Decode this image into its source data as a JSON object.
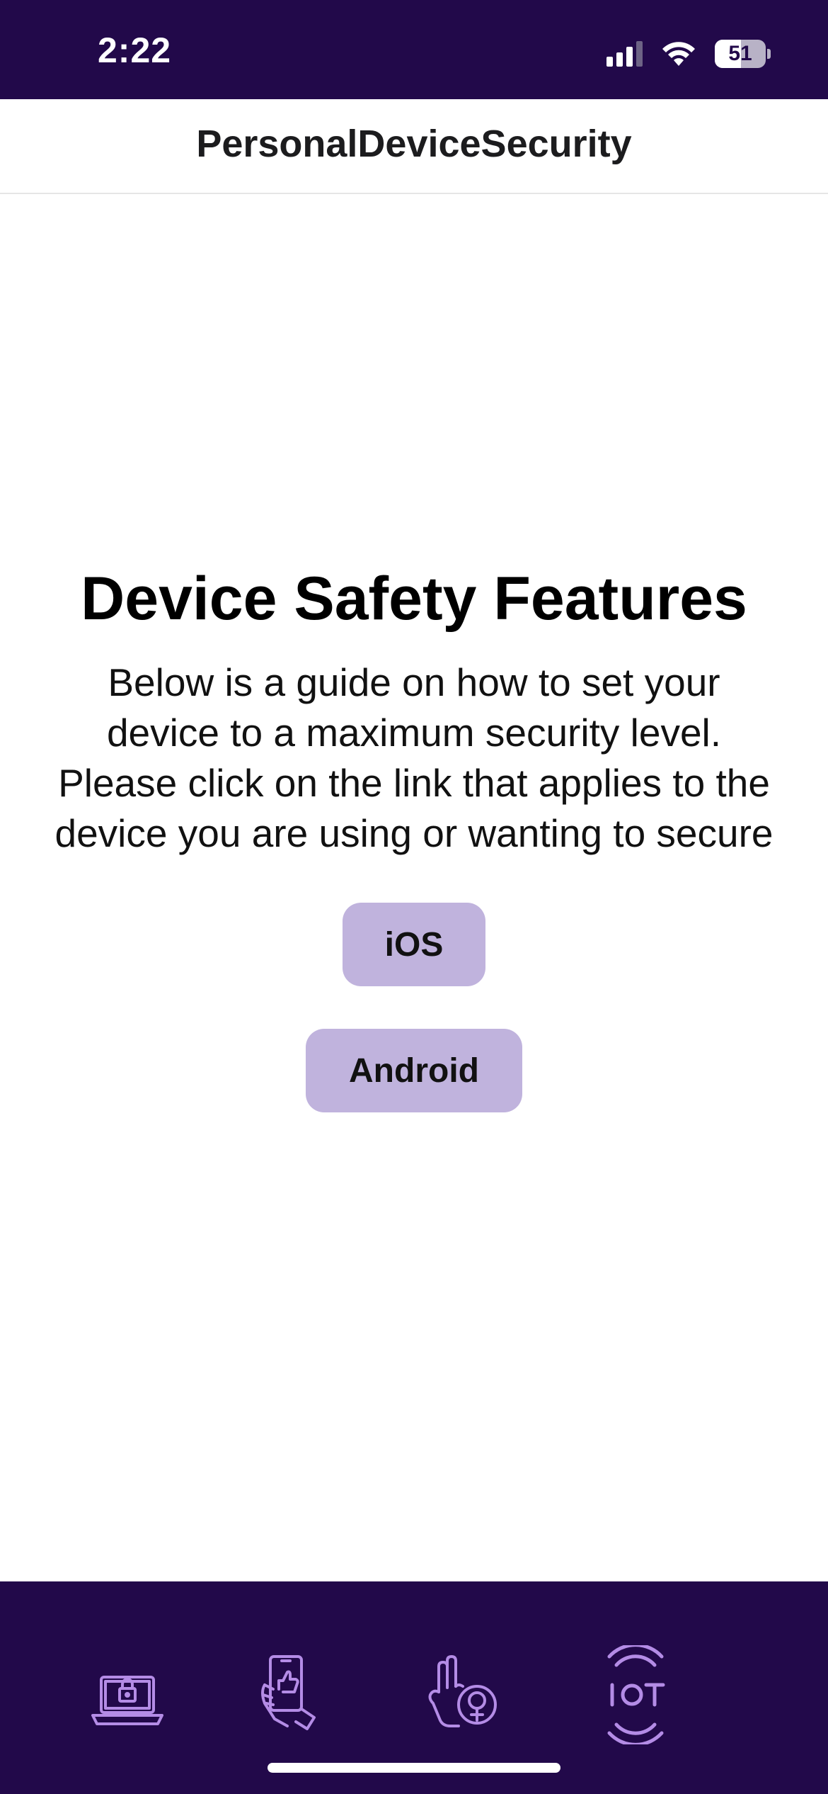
{
  "status_bar": {
    "time": "2:22",
    "battery_level": "51",
    "battery_fraction": 0.51,
    "background_color": "#22094a"
  },
  "nav": {
    "title": "PersonalDeviceSecurity"
  },
  "main": {
    "title": "Device Safety Features",
    "description": "Below is a guide on how to set your device to a maximum security level. Please click on the link that applies to the device you are using or wanting to secure",
    "buttons": {
      "ios_label": "iOS",
      "android_label": "Android"
    },
    "button_color": "#c0b3dd"
  },
  "tab_bar": {
    "background_color": "#22094a",
    "icon_color": "#b48ce6",
    "items": [
      {
        "icon": "laptop-lock-icon"
      },
      {
        "icon": "hand-phone-thumbs-up-icon"
      },
      {
        "icon": "hand-female-symbol-icon"
      },
      {
        "icon": "iot-signal-icon"
      }
    ]
  }
}
